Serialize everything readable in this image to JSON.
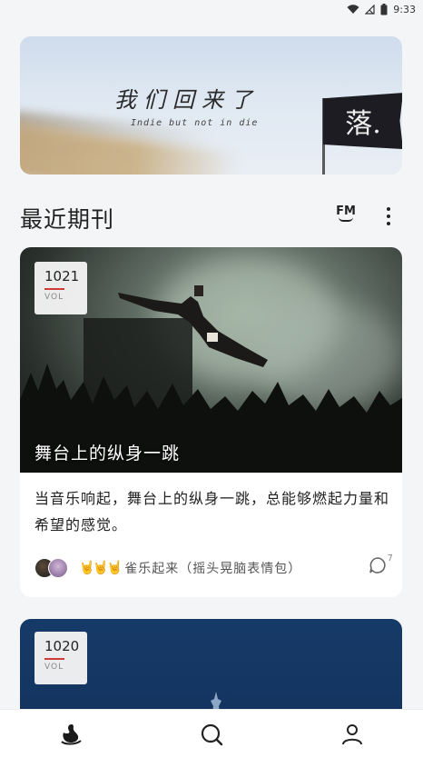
{
  "status_bar": {
    "time": "9:33"
  },
  "banner": {
    "title": "我们回来了",
    "subtitle": "Indie but not in die",
    "flag_text": "落."
  },
  "section": {
    "title": "最近期刊",
    "fm_label": "FM"
  },
  "cards": [
    {
      "vol_number": "1021",
      "vol_label": "VOL",
      "image_caption": "舞台上的纵身一跳",
      "description": "当音乐响起，舞台上的纵身一跳，总能够燃起力量和希望的感觉。",
      "hands": "🤘🤘🤘",
      "footer_text": "雀乐起来（摇头晃脑表情包）",
      "comment_count": "7"
    },
    {
      "vol_number": "1020",
      "vol_label": "VOL"
    }
  ],
  "nav": {
    "items": [
      "home-icon",
      "search-icon",
      "profile-icon"
    ]
  },
  "colors": {
    "accent": "#d23a3a",
    "card2_bg": "#163a68"
  }
}
